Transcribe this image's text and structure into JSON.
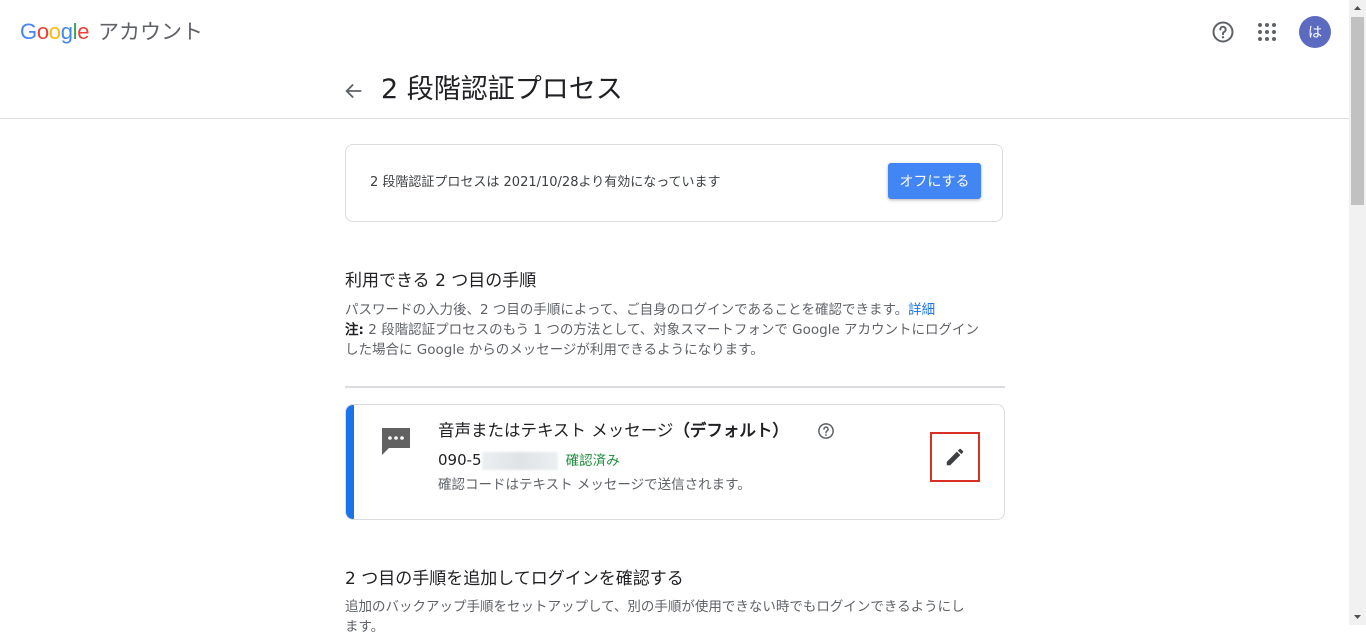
{
  "header": {
    "logo_text": "Google",
    "product": "アカウント",
    "avatar_letter": "は",
    "icons": [
      "help-icon",
      "apps-grid-icon"
    ]
  },
  "page": {
    "title": "2 段階認証プロセス",
    "back_icon": "arrow-left-icon"
  },
  "status": {
    "text": "2 段階認証プロセスは 2021/10/28より有効になっています",
    "off_button": "オフにする"
  },
  "second_steps": {
    "title": "利用できる 2 つ目の手順",
    "desc_line1": "パスワードの入力後、2 つ目の手順によって、ご自身のログインであることを確認できます。",
    "desc_link": "詳細",
    "note_label": "注:",
    "note_line1": " 2 段階認証プロセスのもう 1 つの方法として、対象スマートフォンで Google アカウントにログイン",
    "note_line2": "した場合に Google からのメッセージが利用できるようになります。"
  },
  "method": {
    "title": "音声またはテキスト メッセージ",
    "default_label": "（デフォルト）",
    "phone_prefix": "090-5",
    "verified": "確認済み",
    "subtitle": "確認コードはテキスト メッセージで送信されます。",
    "icon": "message-icon",
    "edit_icon": "pencil-icon"
  },
  "add_steps": {
    "title": "2 つ目の手順を追加してログインを確認する",
    "desc_line1": "追加のバックアップ手順をセットアップして、別の手順が使用できない時でもログインできるようにし",
    "desc_line2": "ます。"
  },
  "colors": {
    "primary_button": "#4285f4",
    "accent": "#1a73e8",
    "verified": "#1e8e3e",
    "highlight_box": "#d93025"
  }
}
